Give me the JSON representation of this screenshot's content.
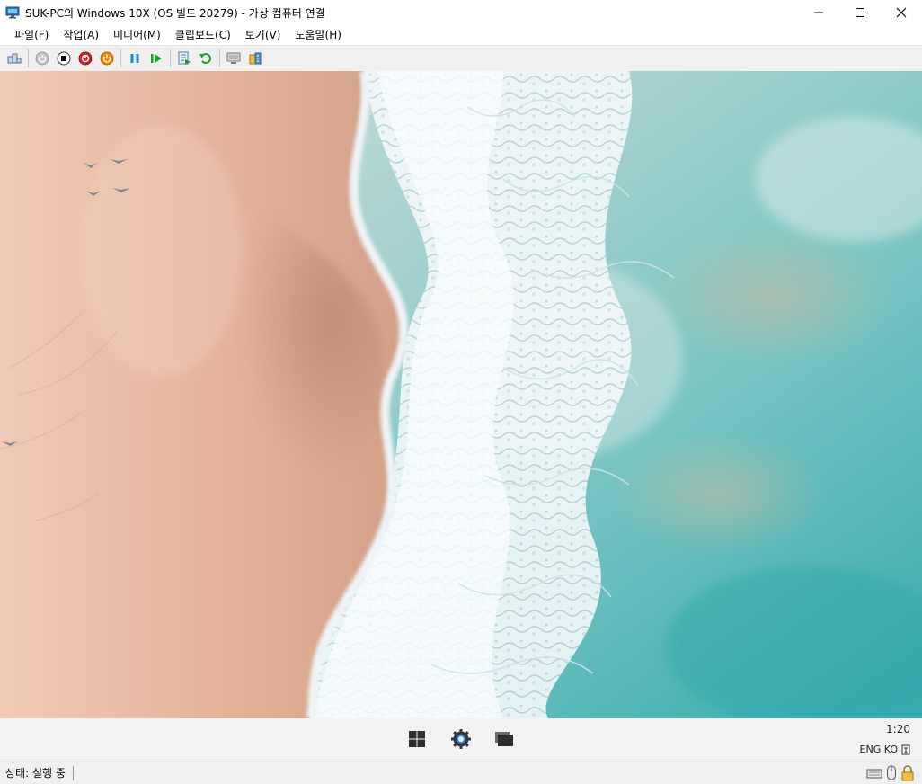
{
  "window": {
    "title": "SUK-PC의 Windows 10X (OS 빌드 20279) - 가상 컴퓨터 연결",
    "icon": "vm-connect-icon",
    "controls": [
      "minimize-icon",
      "maximize-icon",
      "close-icon"
    ]
  },
  "menu": [
    {
      "label": "파일(F)"
    },
    {
      "label": "작업(A)"
    },
    {
      "label": "미디어(M)"
    },
    {
      "label": "클립보드(C)"
    },
    {
      "label": "보기(V)"
    },
    {
      "label": "도움말(H)"
    }
  ],
  "toolbar": {
    "buttons": [
      "ctrl-alt-del-icon",
      "start-icon",
      "turn-off-icon",
      "shutdown-icon",
      "power-icon",
      "pause-icon",
      "resume-icon",
      "checkpoint-icon",
      "revert-icon",
      "enhanced-session-icon",
      "share-icon"
    ]
  },
  "taskbar": {
    "apps": [
      "windows-start-icon",
      "settings-icon",
      "task-view-icon"
    ],
    "clock": "1:20",
    "language": "ENG KO"
  },
  "status": {
    "text": "상태: 실행 중",
    "icons": [
      "keyboard-icon",
      "mouse-icon",
      "lock-icon"
    ]
  },
  "colors": {
    "sand": "#e8bfa8",
    "sea_foam": "#e6eef0",
    "sea_turquoise": "#5fb7b9",
    "toolbar_bg": "#f0f0f0"
  }
}
